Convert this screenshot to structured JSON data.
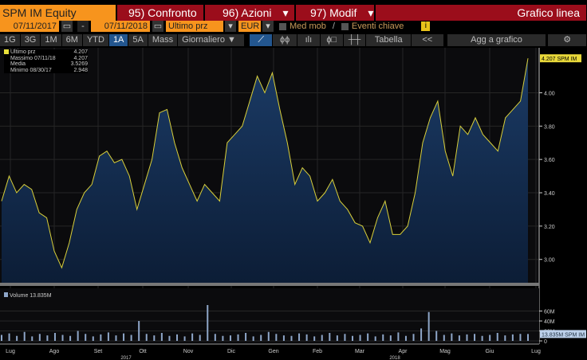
{
  "header": {
    "ticker": "SPM IM Equity",
    "btn95": "95) Confronto",
    "btn96": "96) Azioni",
    "btn97": "97) Modif",
    "chart_type": "Grafico linea"
  },
  "controls": {
    "start_date": "07/11/2017",
    "end_date": "07/11/2018",
    "dash": "-",
    "field": "Ultimo prz",
    "currency": "EUR",
    "med_mob": "Med mob",
    "eventi": "Eventi chiave",
    "info": "i"
  },
  "toolbar": {
    "periods": [
      "1G",
      "3G",
      "1M",
      "6M",
      "YTD",
      "1A",
      "5A",
      "Mass"
    ],
    "active": "1A",
    "frequency": "Giornaliero ▼",
    "tabella": "Tabella",
    "collapse": "<<",
    "add": "Agg a grafico",
    "settings": "⚙"
  },
  "legend": {
    "items": [
      {
        "label": "Ultimo prz",
        "value": "4.207"
      },
      {
        "label": "Massimo 07/11/18",
        "value": "4.207"
      },
      {
        "label": "Media",
        "value": "3.5269"
      },
      {
        "label": "Minimo 08/30/17",
        "value": "2.948"
      }
    ]
  },
  "volume_legend": "Volume 13.835M",
  "last_price_label": "4.207 SPM IM",
  "last_volume_label": "13.835M SPM IM",
  "chart_data": {
    "type": "line",
    "title": "SPM IM Equity",
    "y_ticks": [
      "4.00",
      "3.80",
      "3.60",
      "3.40",
      "3.20",
      "3.00"
    ],
    "ylim": [
      2.86,
      4.27
    ],
    "x_ticks": [
      "Lug",
      "Ago",
      "Set",
      "Ott",
      "Nov",
      "Dic",
      "Gen",
      "Feb",
      "Mar",
      "Apr",
      "Mag",
      "Giu",
      "Lug"
    ],
    "year_labels": [
      "2017",
      "2018"
    ],
    "values": [
      3.35,
      3.5,
      3.4,
      3.45,
      3.42,
      3.28,
      3.25,
      3.05,
      2.95,
      3.1,
      3.3,
      3.4,
      3.45,
      3.62,
      3.65,
      3.58,
      3.6,
      3.5,
      3.3,
      3.45,
      3.6,
      3.88,
      3.9,
      3.7,
      3.55,
      3.45,
      3.35,
      3.45,
      3.4,
      3.35,
      3.7,
      3.75,
      3.8,
      3.95,
      4.1,
      4.0,
      4.12,
      3.9,
      3.7,
      3.45,
      3.55,
      3.5,
      3.35,
      3.4,
      3.48,
      3.35,
      3.3,
      3.22,
      3.2,
      3.1,
      3.25,
      3.35,
      3.15,
      3.15,
      3.2,
      3.4,
      3.7,
      3.85,
      3.95,
      3.65,
      3.5,
      3.8,
      3.75,
      3.85,
      3.75,
      3.7,
      3.65,
      3.85,
      3.9,
      3.95,
      4.207
    ],
    "volume": {
      "ylim": [
        0,
        80
      ],
      "y_ticks": [
        "60M",
        "40M",
        "20M",
        "0"
      ],
      "values": [
        12,
        15,
        10,
        18,
        9,
        14,
        11,
        16,
        12,
        10,
        20,
        14,
        9,
        13,
        17,
        11,
        15,
        12,
        40,
        14,
        11,
        16,
        10,
        13,
        9,
        15,
        12,
        72,
        14,
        10,
        11,
        13,
        16,
        9,
        12,
        18,
        14,
        11,
        10,
        15,
        13,
        9,
        12,
        16,
        11,
        14,
        10,
        12,
        15,
        9,
        13,
        11,
        17,
        10,
        14,
        25,
        58,
        20,
        12,
        15,
        11,
        13,
        14,
        10,
        12,
        16,
        11,
        13,
        14,
        13.835
      ]
    }
  }
}
